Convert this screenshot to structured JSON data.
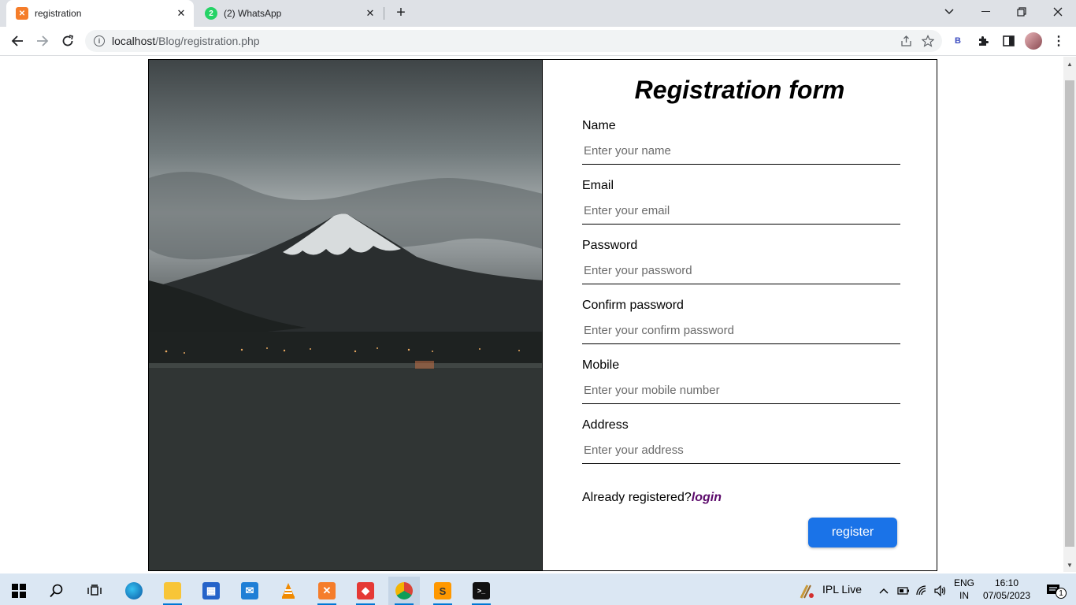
{
  "browser": {
    "tabs": [
      {
        "title": "registration",
        "active": true,
        "icon": "xampp-icon"
      },
      {
        "title": "(2) WhatsApp",
        "active": false,
        "icon": "whatsapp-icon",
        "badge": "2"
      }
    ],
    "url_host": "localhost",
    "url_path": "/Blog/registration.php",
    "extension_label": "B"
  },
  "form": {
    "title": "Registration form",
    "fields": [
      {
        "label": "Name",
        "placeholder": "Enter your name"
      },
      {
        "label": "Email",
        "placeholder": "Enter your email"
      },
      {
        "label": "Password",
        "placeholder": "Enter your password"
      },
      {
        "label": "Confirm password",
        "placeholder": "Enter your confirm password"
      },
      {
        "label": "Mobile",
        "placeholder": "Enter your mobile number"
      },
      {
        "label": "Address",
        "placeholder": "Enter your address"
      }
    ],
    "already_text": "Already registered?",
    "login_link": "login",
    "register_button": "register"
  },
  "taskbar": {
    "weather_label": "IPL Live",
    "language_top": "ENG",
    "language_bottom": "IN",
    "time": "16:10",
    "date": "07/05/2023",
    "notification_count": "1"
  },
  "colors": {
    "accent": "#1a73e8",
    "login_link": "#5c0a6b",
    "tabbar": "#dee1e6",
    "taskbar": "#dbe7f3"
  }
}
